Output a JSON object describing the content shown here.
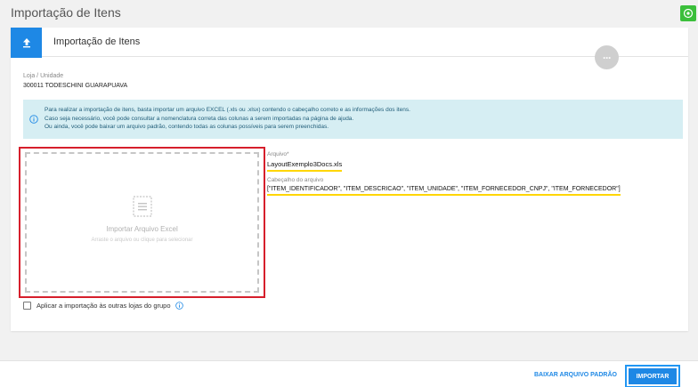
{
  "page": {
    "title": "Importação de Itens"
  },
  "card": {
    "title": "Importação de Itens",
    "more_label": "···"
  },
  "store": {
    "label": "Loja / Unidade",
    "value": "300011 TODESCHINI GUARAPUAVA"
  },
  "info": {
    "line1": "Para realizar a importação de itens, basta importar um arquivo EXCEL (.xls ou .xlsx) contendo o cabeçalho correto e as informações dos itens.",
    "line2": "Caso seja necessário, você pode consultar a nomenclatura correta das colunas a serem importadas na página de ajuda.",
    "line3": "Ou ainda, você pode baixar um arquivo padrão, contendo todas as colunas possíveis para serem preenchidas."
  },
  "dropzone": {
    "title": "Importar Arquivo Excel",
    "subtitle": "Arraste o arquivo ou clique para selecionar",
    "icon": "file-icon"
  },
  "file": {
    "label": "Arquivo*",
    "value": "LayoutExemplo3Docs.xls",
    "header_label": "Cabeçalho do arquivo",
    "header_value": "[\"ITEM_IDENTIFICADOR\", \"ITEM_DESCRICAO\", \"ITEM_UNIDADE\", \"ITEM_FORNECEDOR_CNPJ\", \"ITEM_FORNECEDOR\"]"
  },
  "apply": {
    "label": "Aplicar a importação às outras lojas do grupo",
    "checked": false
  },
  "footer": {
    "download_label": "BAIXAR ARQUIVO PADRÃO",
    "import_label": "IMPORTAR"
  },
  "colors": {
    "primary": "#1e88e5",
    "info_bg": "#d6eef3",
    "highlight_red": "#d61f2c",
    "highlight_yellow": "#ffd600",
    "eye_green": "#3bbf3b"
  }
}
